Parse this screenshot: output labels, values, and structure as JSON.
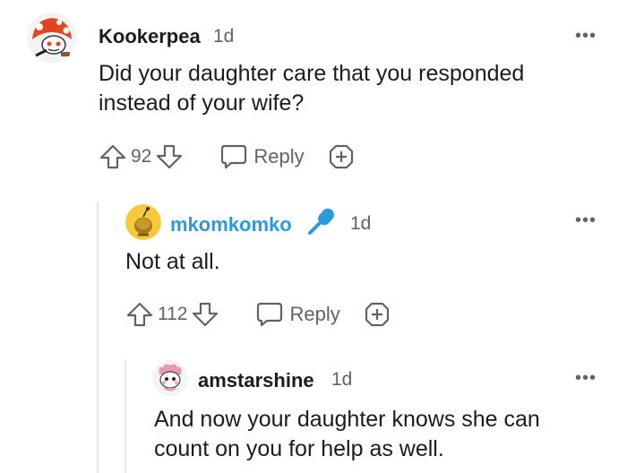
{
  "comments": [
    {
      "username": "Kookerpea",
      "time": "1d",
      "text": "Did your daughter care that you responded instead of your wife?",
      "votes": "92",
      "reply_label": "Reply",
      "username_color": "#1c1c1c"
    },
    {
      "username": "mkomkomko",
      "time": "1d",
      "text": "Not at all.",
      "votes": "112",
      "reply_label": "Reply",
      "username_color": "#2e9ad9",
      "flair_icon": "microphone-icon"
    },
    {
      "username": "amstarshine",
      "time": "1d",
      "text": "And now your daughter knows she can count on you for help as well."
    }
  ],
  "colors": {
    "text": "#1c1c1c",
    "meta": "#5f6368",
    "op_blue": "#2e9ad9",
    "thread_line": "#e6e6e6"
  },
  "icons": [
    "snoo-avatar-icon",
    "snoo-avatar-icon",
    "snoo-avatar-icon",
    "upvote-icon",
    "downvote-icon",
    "comment-bubble-icon",
    "award-plus-icon",
    "more-options-icon",
    "microphone-icon"
  ]
}
